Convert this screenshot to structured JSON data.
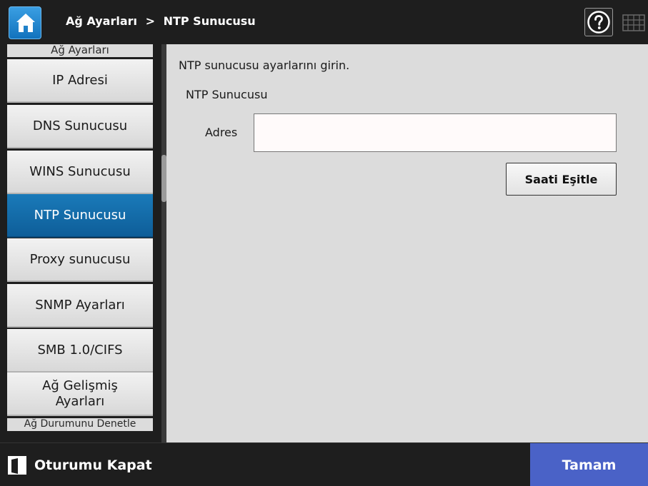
{
  "header": {
    "breadcrumb_parent": "Ağ Ayarları",
    "breadcrumb_separator": ">",
    "breadcrumb_current": "NTP Sunucusu",
    "home_icon": "home-icon",
    "help_icon": "help-icon",
    "keyboard_icon": "keyboard-icon"
  },
  "sidebar": {
    "header_top": "Ağ Ayarları",
    "items": [
      {
        "label": "IP Adresi"
      },
      {
        "label": "DNS Sunucusu"
      },
      {
        "label": "WINS Sunucusu"
      },
      {
        "label": "NTP Sunucusu"
      },
      {
        "label": "Proxy sunucusu"
      },
      {
        "label": "SNMP Ayarları"
      },
      {
        "label": "SMB 1.0/CIFS"
      },
      {
        "label": "Ağ Gelişmiş Ayarları"
      }
    ],
    "active_item": "NTP Sunucusu",
    "header_bottom": "Ağ Durumunu Denetle"
  },
  "main": {
    "instruction": "NTP sunucusu ayarlarını girin.",
    "section_label": "NTP Sunucusu",
    "address_label": "Adres",
    "address_value": "",
    "sync_button": "Saati Eşitle"
  },
  "footer": {
    "logout_label": "Oturumu Kapat",
    "ok_label": "Tamam"
  },
  "colors": {
    "accent_active": "#1273bd",
    "ok_button": "#4a62c7",
    "background_dark": "#1e1e1e",
    "panel": "#dcdcdc"
  }
}
